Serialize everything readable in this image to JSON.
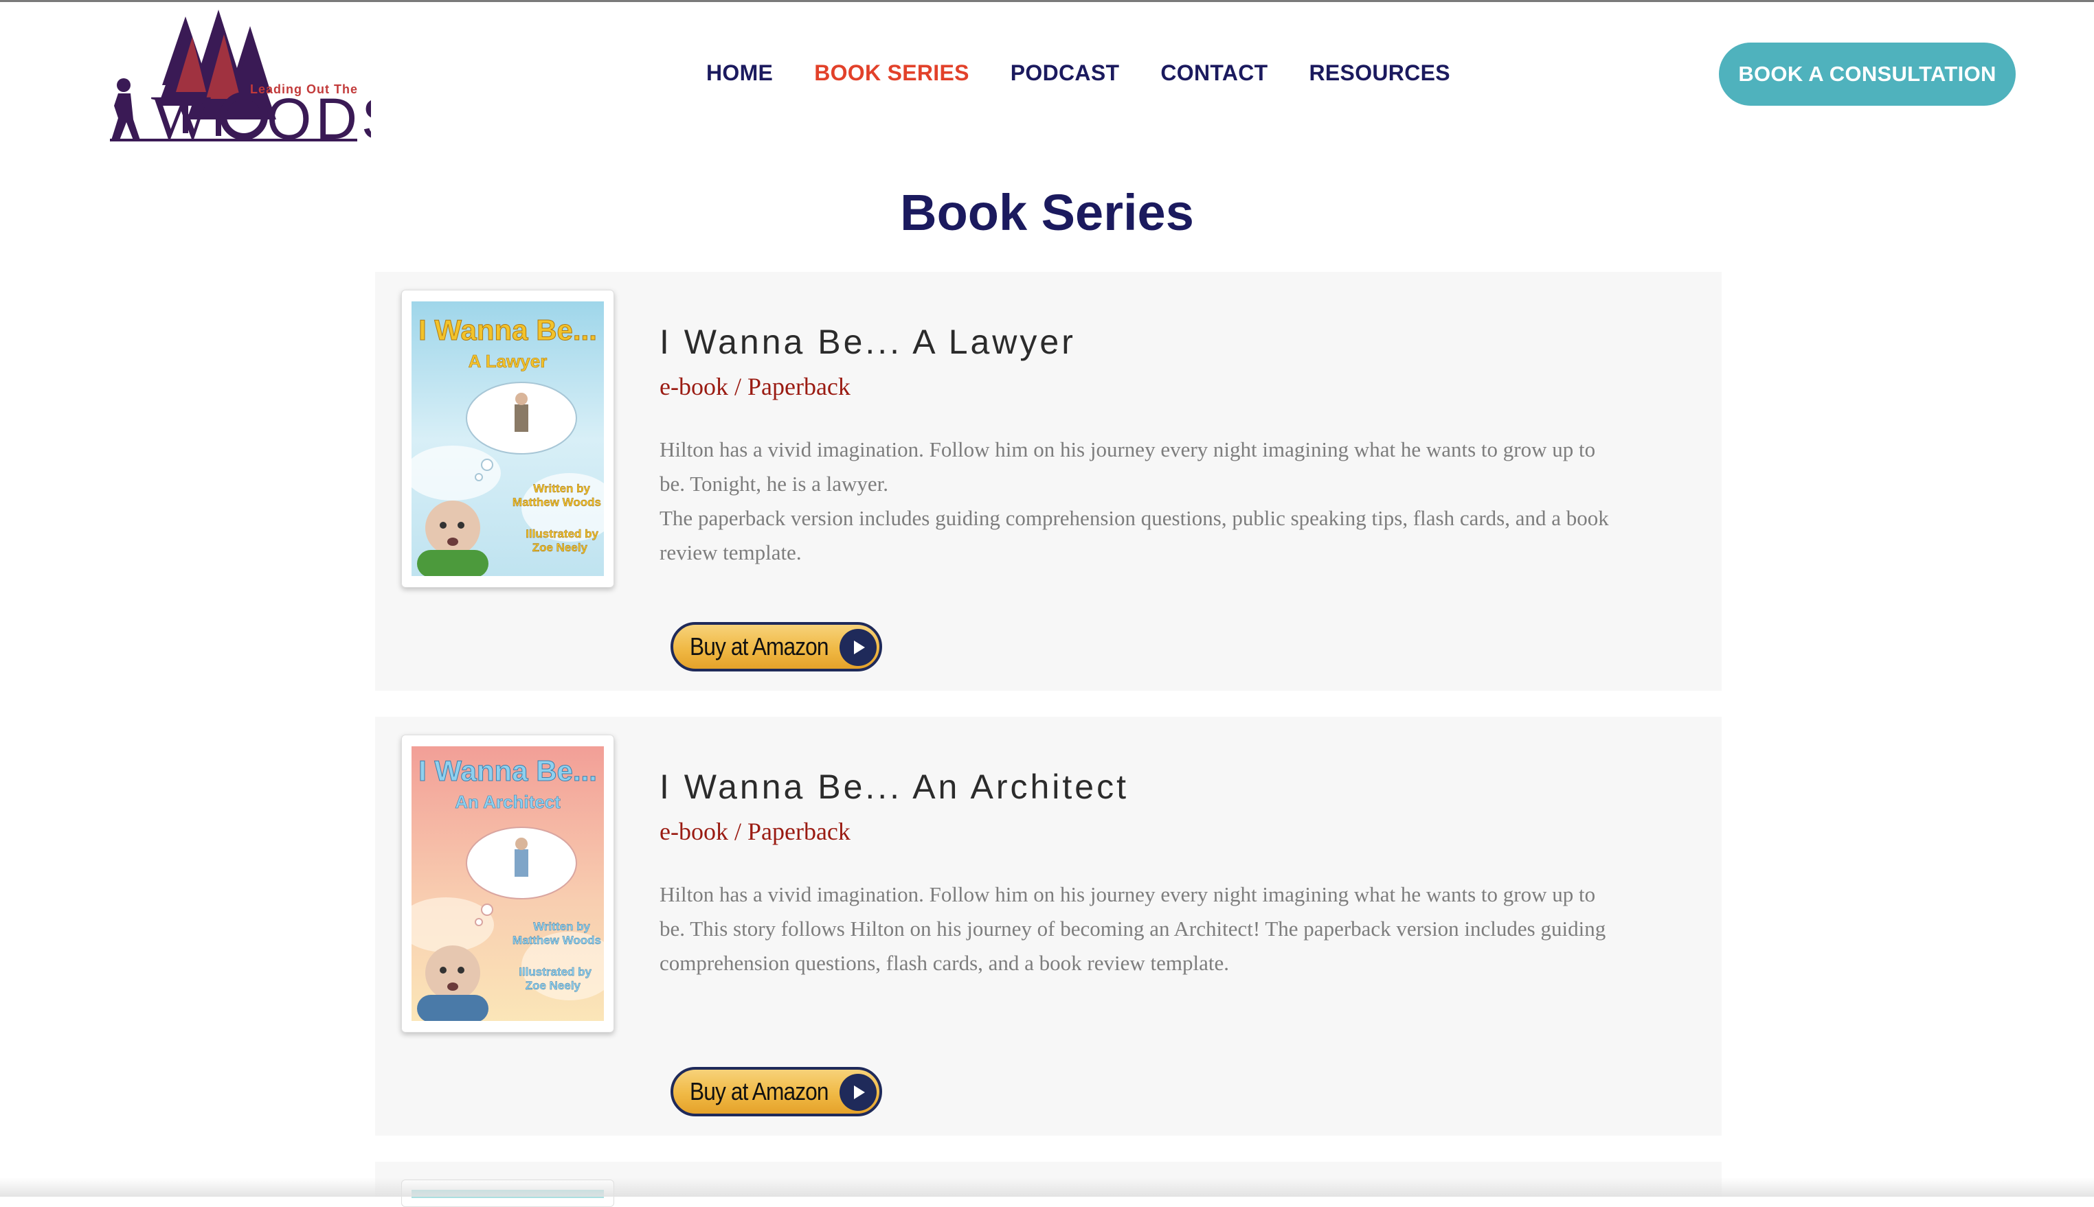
{
  "header": {
    "logo_text": {
      "tagline": "Leading Out The",
      "brand": "WOODS"
    },
    "nav": [
      {
        "label": "HOME",
        "active": false
      },
      {
        "label": "BOOK SERIES",
        "active": true
      },
      {
        "label": "PODCAST",
        "active": false
      },
      {
        "label": "CONTACT",
        "active": false
      },
      {
        "label": "RESOURCES",
        "active": false
      }
    ],
    "cta_label": "BOOK A CONSULTATION"
  },
  "page": {
    "title": "Book Series"
  },
  "books": [
    {
      "title": "I Wanna Be... A Lawyer",
      "format_ebook": "e-book",
      "format_sep": " / ",
      "format_paperback": "Paperback",
      "description": [
        "Hilton has a vivid imagination. Follow him on his journey every night imagining what he wants to grow up to be. Tonight, he is a lawyer.",
        "The paperback version includes guiding comprehension questions, public speaking tips, flash cards, and a book review template."
      ],
      "button_label": "Buy at Amazon",
      "cover": {
        "title": "I Wanna Be...",
        "subtitle": "A Lawyer",
        "written_by": "Written by",
        "author": "Matthew Woods",
        "illustrated_by": "Illustrated by",
        "illustrator": "Zoe Neely",
        "bg_top": "#bfe6f0",
        "bg_bottom": "#e9f6fb",
        "title_color": "#f2c32b",
        "shirt_color": "#4c9a3c"
      }
    },
    {
      "title": "I Wanna Be... An Architect",
      "format_ebook": "e-book",
      "format_sep": " / ",
      "format_paperback": "Paperback",
      "description": [
        "Hilton has a vivid imagination. Follow him on his journey every night imagining what he wants to grow up to be. This story follows Hilton on his journey of becoming an Architect! The paperback version includes guiding comprehension questions, flash cards, and a book review template."
      ],
      "button_label": "Buy at Amazon",
      "cover": {
        "title": "I Wanna Be...",
        "subtitle": "An Architect",
        "written_by": "Written by",
        "author": "Matthew Woods",
        "illustrated_by": "Illustrated by",
        "illustrator": "Zoe Neely",
        "bg_top": "#f4a8a0",
        "bg_bottom": "#fbe8c0",
        "title_color": "#8fd0ee",
        "shirt_color": "#4a7aa8"
      }
    }
  ],
  "colors": {
    "navy": "#1b1a5e",
    "active_nav": "#e2412a",
    "cta": "#4fb2bd",
    "format_link": "#9a1b12",
    "card_bg": "#f7f7f7"
  }
}
